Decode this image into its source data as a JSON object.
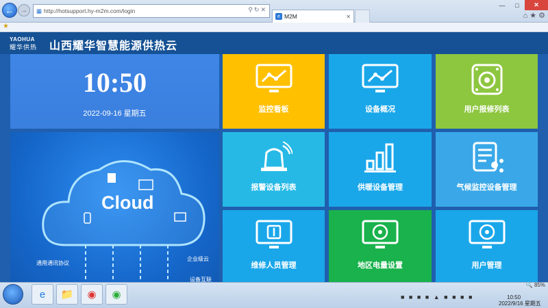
{
  "browser": {
    "url": "http://hotsupport.hy-m2m.com/login",
    "tab_title": "M2M",
    "tab_favicon": "e"
  },
  "header": {
    "logo_line1": "YAOHUA",
    "logo_line2": "耀华供热",
    "title": "山西耀华智慧能源供热云"
  },
  "clock": {
    "time": "10:50",
    "date": "2022-09-16 星期五"
  },
  "cloud": {
    "label": "Cloud",
    "text_left": "通用通讯协议",
    "text_right1": "企业级云",
    "text_right2": "设备互联"
  },
  "tiles": [
    {
      "label": "监控看板",
      "icon": "monitor-chart-icon",
      "color": "#ffc000"
    },
    {
      "label": "设备概况",
      "icon": "monitor-chart-icon",
      "color": "#1aa7ea"
    },
    {
      "label": "用户报修列表",
      "icon": "speaker-icon",
      "color": "#8dc63f"
    },
    {
      "label": "报警设备列表",
      "icon": "alarm-light-icon",
      "color": "#27b9e6"
    },
    {
      "label": "供暖设备管理",
      "icon": "bar-chart-icon",
      "color": "#1aa7ea"
    },
    {
      "label": "气候监控设备管理",
      "icon": "document-share-icon",
      "color": "#3aa8e8"
    },
    {
      "label": "维修人员管理",
      "icon": "monitor-device-icon",
      "color": "#1aa7ea"
    },
    {
      "label": "地区电量设置",
      "icon": "monitor-signal-icon",
      "color": "#19b24c"
    },
    {
      "label": "用户管理",
      "icon": "monitor-signal-icon",
      "color": "#1aa7ea"
    }
  ],
  "status": {
    "zoom": "85%"
  },
  "taskbar": {
    "time": "10:50",
    "date": "2022/9/16 星期五"
  }
}
